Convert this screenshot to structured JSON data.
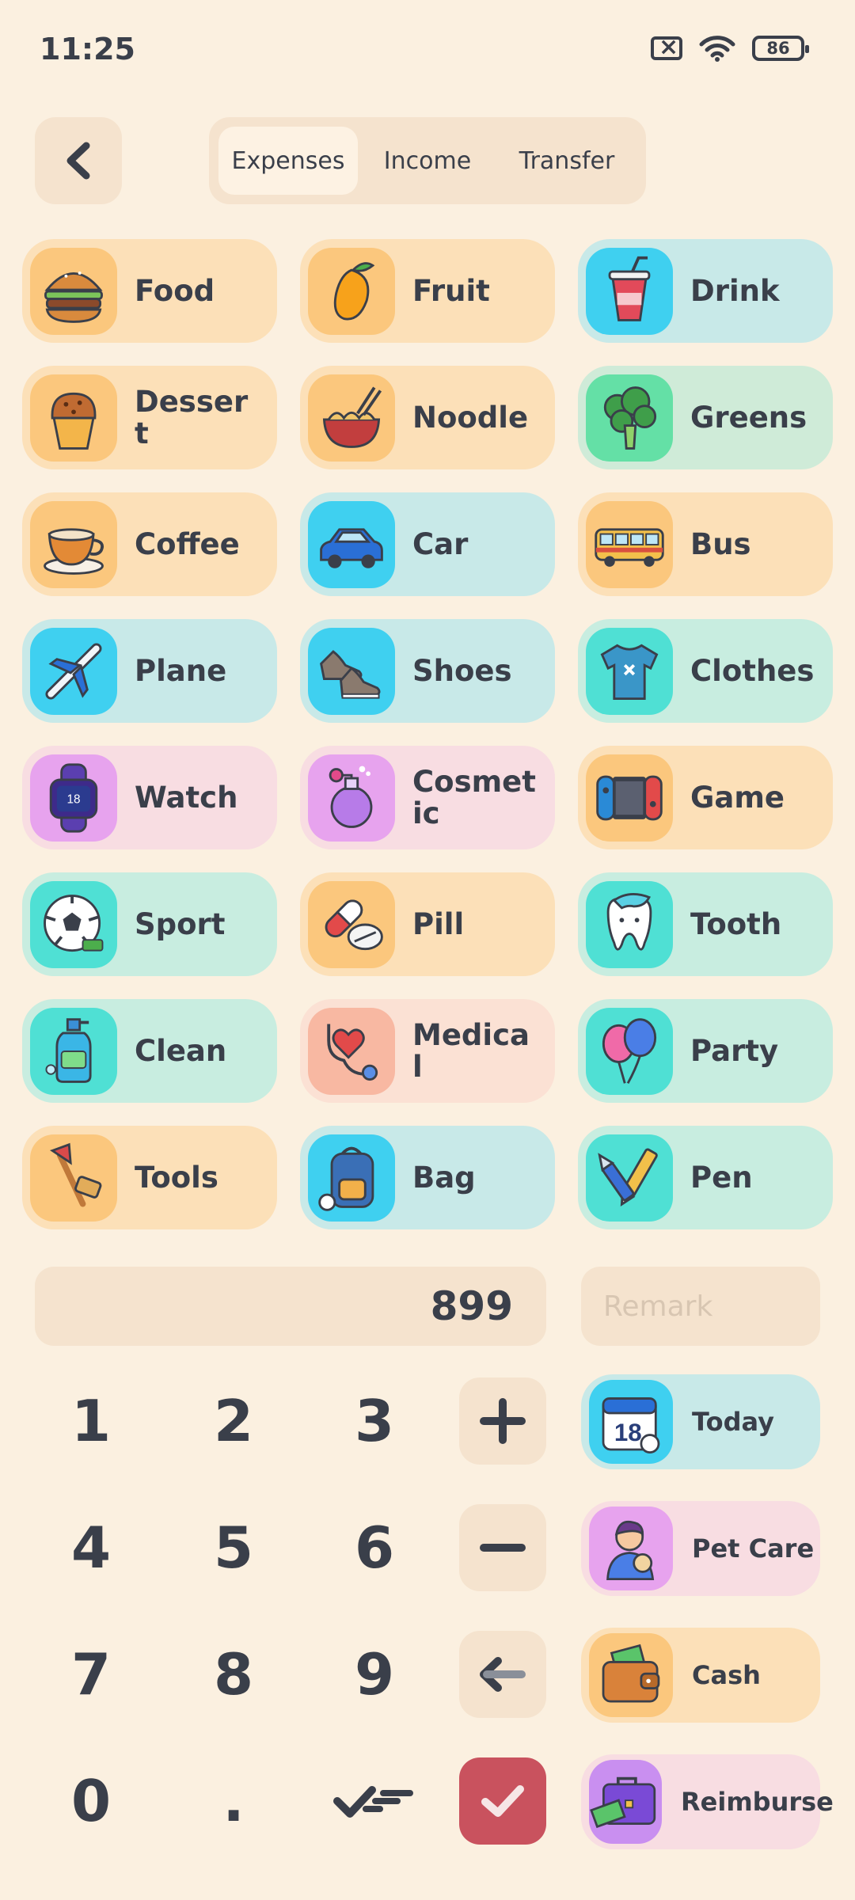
{
  "status_bar": {
    "time": "11:25",
    "battery": "86"
  },
  "header": {
    "tabs": [
      {
        "label": "Expenses",
        "active": true
      },
      {
        "label": "Income",
        "active": false
      },
      {
        "label": "Transfer",
        "active": false
      }
    ]
  },
  "categories": [
    {
      "label": "Food",
      "icon": "burger-icon"
    },
    {
      "label": "Fruit",
      "icon": "mango-icon"
    },
    {
      "label": "Drink",
      "icon": "soda-cup-icon"
    },
    {
      "label": "Dessert",
      "icon": "muffin-icon"
    },
    {
      "label": "Noodle",
      "icon": "noodle-bowl-icon"
    },
    {
      "label": "Greens",
      "icon": "broccoli-icon"
    },
    {
      "label": "Coffee",
      "icon": "coffee-cup-icon"
    },
    {
      "label": "Car",
      "icon": "car-icon"
    },
    {
      "label": "Bus",
      "icon": "bus-icon"
    },
    {
      "label": "Plane",
      "icon": "plane-icon"
    },
    {
      "label": "Shoes",
      "icon": "shoes-icon"
    },
    {
      "label": "Clothes",
      "icon": "tshirt-icon"
    },
    {
      "label": "Watch",
      "icon": "smartwatch-icon"
    },
    {
      "label": "Cosmetic",
      "icon": "perfume-icon"
    },
    {
      "label": "Game",
      "icon": "game-console-icon"
    },
    {
      "label": "Sport",
      "icon": "soccer-ball-icon"
    },
    {
      "label": "Pill",
      "icon": "pill-icon"
    },
    {
      "label": "Tooth",
      "icon": "tooth-icon"
    },
    {
      "label": "Clean",
      "icon": "soap-bottle-icon"
    },
    {
      "label": "Medical",
      "icon": "stethoscope-icon"
    },
    {
      "label": "Party",
      "icon": "balloons-icon"
    },
    {
      "label": "Tools",
      "icon": "axe-icon"
    },
    {
      "label": "Bag",
      "icon": "backpack-icon"
    },
    {
      "label": "Pen",
      "icon": "pen-cutter-icon"
    }
  ],
  "amount": "899",
  "remark_placeholder": "Remark",
  "keypad": {
    "digits": [
      "1",
      "2",
      "3",
      "4",
      "5",
      "6",
      "7",
      "8",
      "9",
      "0",
      "."
    ],
    "ops": [
      "plus-icon",
      "minus-icon",
      "backspace-icon",
      "confirm-check-icon"
    ]
  },
  "side_options": [
    {
      "label": "Today",
      "icon": "calendar-icon"
    },
    {
      "label": "Pet Care",
      "icon": "pet-owner-icon"
    },
    {
      "label": "Cash",
      "icon": "wallet-icon"
    },
    {
      "label": "Reimburse",
      "icon": "briefcase-money-icon"
    }
  ],
  "colors": {
    "background": "#fbf0e0",
    "confirm": "#c9525e",
    "text": "#3a3f4a"
  }
}
